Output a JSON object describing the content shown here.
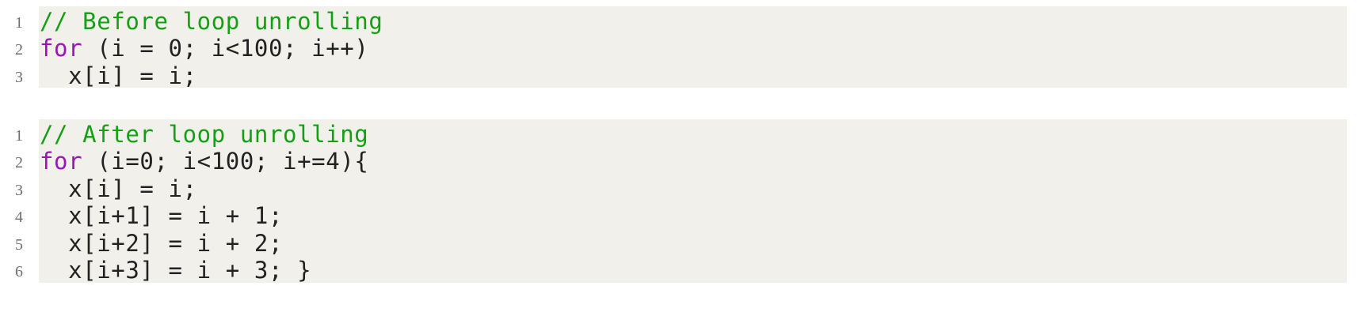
{
  "listings": [
    {
      "name": "before-loop-unrolling",
      "lines": [
        {
          "number": "1",
          "tokens": [
            {
              "type": "comment",
              "text": "// Before loop unrolling"
            }
          ]
        },
        {
          "number": "2",
          "tokens": [
            {
              "type": "keyword",
              "text": "for"
            },
            {
              "type": "plain",
              "text": " (i = 0; i<100; i++)"
            }
          ]
        },
        {
          "number": "3",
          "tokens": [
            {
              "type": "plain",
              "text": "  x[i] = i;"
            }
          ]
        }
      ]
    },
    {
      "name": "after-loop-unrolling",
      "lines": [
        {
          "number": "1",
          "tokens": [
            {
              "type": "comment",
              "text": "// After loop unrolling"
            }
          ]
        },
        {
          "number": "2",
          "tokens": [
            {
              "type": "keyword",
              "text": "for"
            },
            {
              "type": "plain",
              "text": " (i=0; i<100; i+=4){"
            }
          ]
        },
        {
          "number": "3",
          "tokens": [
            {
              "type": "plain",
              "text": "  x[i] = i;"
            }
          ]
        },
        {
          "number": "4",
          "tokens": [
            {
              "type": "plain",
              "text": "  x[i+1] = i + 1;"
            }
          ]
        },
        {
          "number": "5",
          "tokens": [
            {
              "type": "plain",
              "text": "  x[i+2] = i + 2;"
            }
          ]
        },
        {
          "number": "6",
          "tokens": [
            {
              "type": "plain",
              "text": "  x[i+3] = i + 3; }"
            }
          ]
        }
      ]
    }
  ],
  "colors": {
    "background": "#f1f0ea",
    "comment": "#12a112",
    "keyword": "#9b14b7",
    "text": "#222222",
    "line_number": "#6e6e6e"
  }
}
